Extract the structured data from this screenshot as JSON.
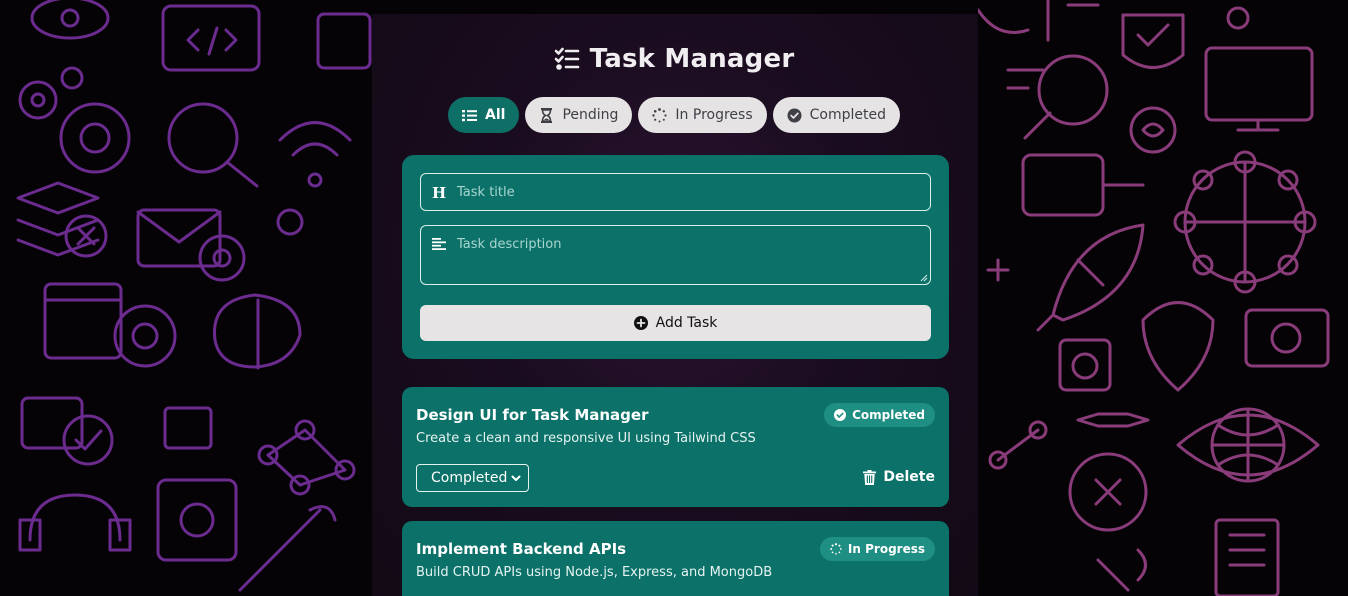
{
  "app": {
    "title": "Task Manager"
  },
  "filters": [
    {
      "label": "All",
      "icon": "list-icon",
      "active": true
    },
    {
      "label": "Pending",
      "icon": "hourglass-icon",
      "active": false
    },
    {
      "label": "In Progress",
      "icon": "spinner-icon",
      "active": false
    },
    {
      "label": "Completed",
      "icon": "check-circle-icon",
      "active": false
    }
  ],
  "form": {
    "title_placeholder": "Task title",
    "description_placeholder": "Task description",
    "add_label": "Add Task"
  },
  "tasks": [
    {
      "title": "Design UI for Task Manager",
      "description": "Create a clean and responsive UI using Tailwind CSS",
      "status_badge": "Completed",
      "status_select": "Completed",
      "delete_label": "Delete"
    },
    {
      "title": "Implement Backend APIs",
      "description": "Build CRUD APIs using Node.js, Express, and MongoDB",
      "status_badge": "In Progress"
    }
  ],
  "colors": {
    "accent": "#0b7169",
    "badge": "#1f8e83",
    "doodle_left": "#6b2b8f",
    "doodle_right": "#8a3c7a"
  }
}
